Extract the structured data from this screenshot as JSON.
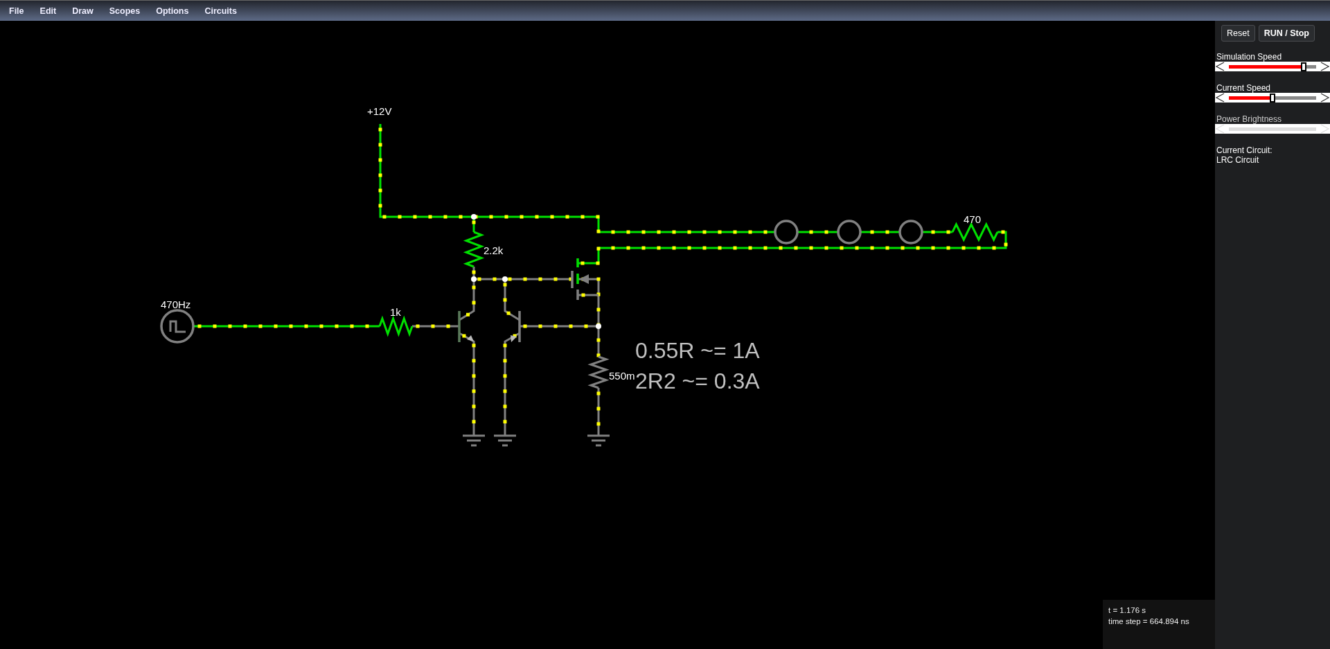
{
  "menu": [
    "File",
    "Edit",
    "Draw",
    "Scopes",
    "Options",
    "Circuits"
  ],
  "schematic": {
    "supply_label": "+12V",
    "source_label": "470Hz",
    "base_resistor": "1k",
    "collector_resistor": "2.2k",
    "load_resistor": "470",
    "sense_resistor": "550m",
    "notes": [
      "0.55R ~= 1A",
      "2R2 ~= 0.3A"
    ]
  },
  "panel": {
    "buttons": [
      "Reset",
      "RUN / Stop"
    ],
    "sliders": [
      {
        "label": "Simulation Speed",
        "level": 0.86,
        "disabled": false
      },
      {
        "label": "Current Speed",
        "level": 0.5,
        "disabled": false
      },
      {
        "label": "Power Brightness",
        "disabled": true
      }
    ],
    "circuit_label": "Current Circuit:",
    "circuit_name": "LRC Circuit"
  },
  "info": [
    "t = 1.176 s",
    "time step = 664.894 ns"
  ]
}
